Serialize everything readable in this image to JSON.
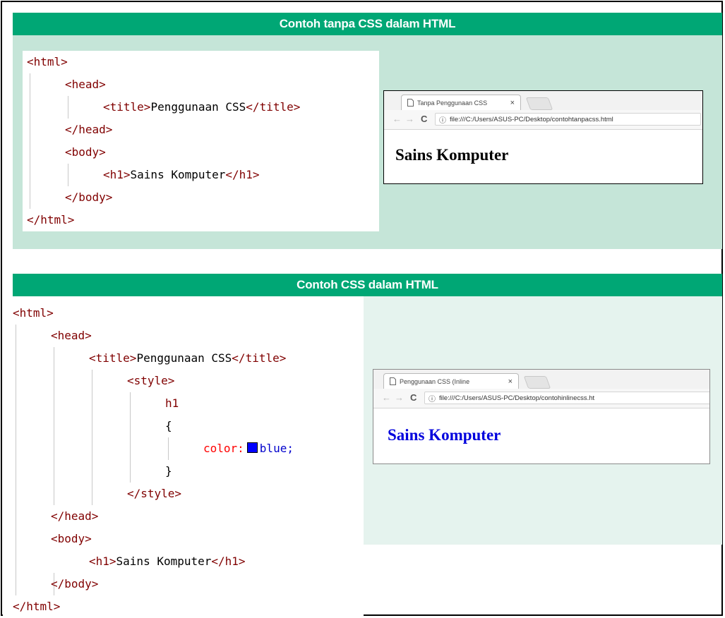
{
  "section1": {
    "title": "Contoh tanpa CSS dalam HTML",
    "code": {
      "l1": "<html>",
      "l2": "<head>",
      "l3a": "<title>",
      "l3b": "Penggunaan CSS",
      "l3c": "</title>",
      "l4": "</head>",
      "l5": "<body>",
      "l6a": "<h1>",
      "l6b": "Sains Komputer",
      "l6c": "</h1>",
      "l7": "</body>",
      "l8": "</html>"
    },
    "browser": {
      "tab_title": "Tanpa Penggunaan CSS",
      "tab_close": "×",
      "url": "file:///C:/Users/ASUS-PC/Desktop/contohtanpacss.html",
      "heading": "Sains Komputer",
      "heading_color": "#000000"
    }
  },
  "section2": {
    "title": "Contoh CSS dalam HTML",
    "code": {
      "l1": "<html>",
      "l2": "<head>",
      "l3a": "<title>",
      "l3b": "Penggunaan CSS",
      "l3c": "</title>",
      "l4": "<style>",
      "l5": "h1",
      "l6": "{",
      "l7a": "color:",
      "l7b": "blue;",
      "l8": "}",
      "l9": "</style>",
      "l10": "</head>",
      "l11": "<body>",
      "l12a": "<h1>",
      "l12b": "Sains Komputer",
      "l12c": "</h1>",
      "l13": "</body>",
      "l14": "</html>"
    },
    "browser": {
      "tab_title": "Penggunaan CSS (Inline",
      "tab_close": "×",
      "url": "file:///C:/Users/ASUS-PC/Desktop/contohinlinecss.ht",
      "heading": "Sains Komputer",
      "heading_color": "#0000dd"
    }
  },
  "colors": {
    "header_green": "#00a775",
    "panel1_bg": "#c5e5d8",
    "panel2_bg": "#e5f3ee",
    "tag_color": "#800000",
    "property_color": "#ff0000",
    "swatch_blue": "#0000ff"
  },
  "icons": [
    "page-icon",
    "close-icon",
    "back-arrow-icon",
    "forward-arrow-icon",
    "reload-icon",
    "info-icon"
  ]
}
